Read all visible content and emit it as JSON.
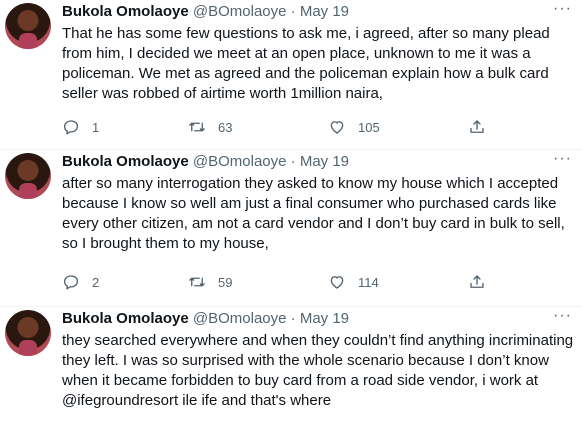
{
  "tweets": [
    {
      "author": {
        "name": "Bukola Omolaoye",
        "handle": "@BOmolaoye"
      },
      "separator": "·",
      "date": "May 19",
      "more_label": "···",
      "text": "That he has some few questions to ask me, i agreed, after so many plead from him, I decided we meet at an open place, unknown to me it was a policeman. We met as agreed and the policeman explain how a bulk card seller was robbed of airtime worth 1million naira,",
      "replies": "1",
      "retweets": "63",
      "likes": "105"
    },
    {
      "author": {
        "name": "Bukola Omolaoye",
        "handle": "@BOmolaoye"
      },
      "separator": "·",
      "date": "May 19",
      "more_label": "···",
      "text": "after so many interrogation they asked to know my house which I accepted because I know so well am just a final consumer who purchased cards like every other citizen, am not a card vendor and I don’t buy card in bulk to sell, so I  brought them to my house,",
      "replies": "2",
      "retweets": "59",
      "likes": "114"
    },
    {
      "author": {
        "name": "Bukola Omolaoye",
        "handle": "@BOmolaoye"
      },
      "separator": "·",
      "date": "May 19",
      "more_label": "···",
      "text": "they searched everywhere and when they couldn’t find anything incriminating they left. I was so surprised with the whole scenario because I don’t know when it became forbidden to buy card from a road side vendor, i work at @ifegroundresort ile ife  and that's where"
    }
  ],
  "icons": {
    "reply": "reply-icon",
    "retweet": "retweet-icon",
    "like": "heart-icon",
    "share": "share-icon",
    "more": "more-icon"
  },
  "colors": {
    "text": "#0f1419",
    "secondary": "#536471",
    "divider": "#eff3f4"
  }
}
